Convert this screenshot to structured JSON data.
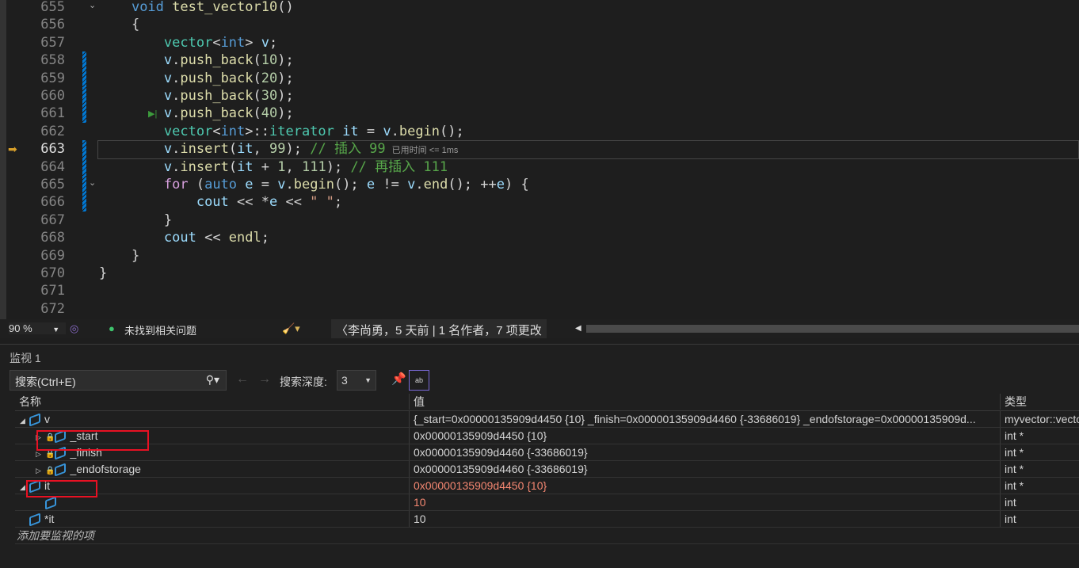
{
  "editor": {
    "current_line": "663",
    "lines": [
      {
        "n": "655",
        "tokens": [
          [
            "    ",
            "p"
          ],
          [
            "void",
            "k"
          ],
          [
            " ",
            "p"
          ],
          [
            "test_vector10",
            "f"
          ],
          [
            "()",
            "p"
          ]
        ]
      },
      {
        "n": "656",
        "tokens": [
          [
            "    {",
            "p"
          ]
        ]
      },
      {
        "n": "657",
        "tokens": [
          [
            "        ",
            "p"
          ],
          [
            "vector",
            "t"
          ],
          [
            "<",
            "p"
          ],
          [
            "int",
            "k"
          ],
          [
            "> ",
            "p"
          ],
          [
            "v",
            "v"
          ],
          [
            ";",
            "p"
          ]
        ]
      },
      {
        "n": "658",
        "tokens": [
          [
            "        ",
            "p"
          ],
          [
            "v",
            "v"
          ],
          [
            ".",
            "p"
          ],
          [
            "push_back",
            "f"
          ],
          [
            "(",
            "p"
          ],
          [
            "10",
            "n"
          ],
          [
            ");",
            "p"
          ]
        ]
      },
      {
        "n": "659",
        "tokens": [
          [
            "        ",
            "p"
          ],
          [
            "v",
            "v"
          ],
          [
            ".",
            "p"
          ],
          [
            "push_back",
            "f"
          ],
          [
            "(",
            "p"
          ],
          [
            "20",
            "n"
          ],
          [
            ");",
            "p"
          ]
        ]
      },
      {
        "n": "660",
        "tokens": [
          [
            "        ",
            "p"
          ],
          [
            "v",
            "v"
          ],
          [
            ".",
            "p"
          ],
          [
            "push_back",
            "f"
          ],
          [
            "(",
            "p"
          ],
          [
            "30",
            "n"
          ],
          [
            ");",
            "p"
          ]
        ]
      },
      {
        "n": "661",
        "tokens": [
          [
            "        ",
            "p"
          ],
          [
            "v",
            "v"
          ],
          [
            ".",
            "p"
          ],
          [
            "push_back",
            "f"
          ],
          [
            "(",
            "p"
          ],
          [
            "40",
            "n"
          ],
          [
            ");",
            "p"
          ]
        ]
      },
      {
        "n": "662",
        "tokens": [
          [
            "        ",
            "p"
          ],
          [
            "vector",
            "t"
          ],
          [
            "<",
            "p"
          ],
          [
            "int",
            "k"
          ],
          [
            ">::",
            "p"
          ],
          [
            "iterator",
            "t"
          ],
          [
            " ",
            "p"
          ],
          [
            "it",
            "v"
          ],
          [
            " = ",
            "p"
          ],
          [
            "v",
            "v"
          ],
          [
            ".",
            "p"
          ],
          [
            "begin",
            "f"
          ],
          [
            "();",
            "p"
          ]
        ]
      },
      {
        "n": "663",
        "tokens": [
          [
            "        ",
            "p"
          ],
          [
            "v",
            "v"
          ],
          [
            ".",
            "p"
          ],
          [
            "insert",
            "f"
          ],
          [
            "(",
            "p"
          ],
          [
            "it",
            "v"
          ],
          [
            ", ",
            "p"
          ],
          [
            "99",
            "n"
          ],
          [
            "); ",
            "p"
          ],
          [
            "// 插入 99",
            "c"
          ]
        ],
        "hint": "已用时间 <= 1ms"
      },
      {
        "n": "664",
        "tokens": [
          [
            "        ",
            "p"
          ],
          [
            "v",
            "v"
          ],
          [
            ".",
            "p"
          ],
          [
            "insert",
            "f"
          ],
          [
            "(",
            "p"
          ],
          [
            "it",
            "v"
          ],
          [
            " + ",
            "p"
          ],
          [
            "1",
            "n"
          ],
          [
            ", ",
            "p"
          ],
          [
            "111",
            "n"
          ],
          [
            "); ",
            "p"
          ],
          [
            "// 再插入 111",
            "c"
          ]
        ]
      },
      {
        "n": "665",
        "tokens": [
          [
            "        ",
            "p"
          ],
          [
            "for",
            "ctl"
          ],
          [
            " (",
            "p"
          ],
          [
            "auto",
            "k"
          ],
          [
            " ",
            "p"
          ],
          [
            "e",
            "v"
          ],
          [
            " = ",
            "p"
          ],
          [
            "v",
            "v"
          ],
          [
            ".",
            "p"
          ],
          [
            "begin",
            "f"
          ],
          [
            "(); ",
            "p"
          ],
          [
            "e",
            "v"
          ],
          [
            " != ",
            "p"
          ],
          [
            "v",
            "v"
          ],
          [
            ".",
            "p"
          ],
          [
            "end",
            "f"
          ],
          [
            "(); ++",
            "p"
          ],
          [
            "e",
            "v"
          ],
          [
            ") {",
            "p"
          ]
        ]
      },
      {
        "n": "666",
        "tokens": [
          [
            "            ",
            "p"
          ],
          [
            "cout",
            "v"
          ],
          [
            " << *",
            "p"
          ],
          [
            "e",
            "v"
          ],
          [
            " << ",
            "p"
          ],
          [
            "\" \"",
            "s"
          ],
          [
            ";",
            "p"
          ]
        ]
      },
      {
        "n": "667",
        "tokens": [
          [
            "        }",
            "p"
          ]
        ]
      },
      {
        "n": "668",
        "tokens": [
          [
            "        ",
            "p"
          ],
          [
            "cout",
            "v"
          ],
          [
            " << ",
            "p"
          ],
          [
            "endl",
            "f"
          ],
          [
            ";",
            "p"
          ]
        ]
      },
      {
        "n": "669",
        "tokens": [
          [
            "    }",
            "p"
          ]
        ]
      },
      {
        "n": "670",
        "tokens": [
          [
            "}",
            "p"
          ]
        ]
      },
      {
        "n": "671",
        "tokens": []
      },
      {
        "n": "672",
        "tokens": []
      }
    ]
  },
  "status": {
    "zoom": "90 %",
    "issues": "未找到相关问题",
    "blame": "李尚勇，5 天前 | 1 名作者，7 项更改"
  },
  "watch": {
    "title": "监视 1",
    "search_placeholder": "搜索(Ctrl+E)",
    "depth_label": "搜索深度:",
    "depth_value": "3",
    "columns": {
      "name": "名称",
      "value": "值",
      "type": "类型"
    },
    "rows": [
      {
        "name": "v",
        "value": "{_start=0x00000135909d4450 {10} _finish=0x00000135909d4460 {-33686019} _endofstorage=0x00000135909d...",
        "type": "myvector::vector<int>"
      },
      {
        "name": "_start",
        "value": "0x00000135909d4450 {10}",
        "type": "int *"
      },
      {
        "name": "_finish",
        "value": "0x00000135909d4460 {-33686019}",
        "type": "int *"
      },
      {
        "name": "_endofstorage",
        "value": "0x00000135909d4460 {-33686019}",
        "type": "int *"
      },
      {
        "name": "it",
        "value": "0x00000135909d4450 {10}",
        "type": "int *"
      },
      {
        "name": "",
        "value": "10",
        "type": "int"
      },
      {
        "name": "*it",
        "value": "10",
        "type": "int"
      }
    ],
    "add_item": "添加要监视的项"
  }
}
